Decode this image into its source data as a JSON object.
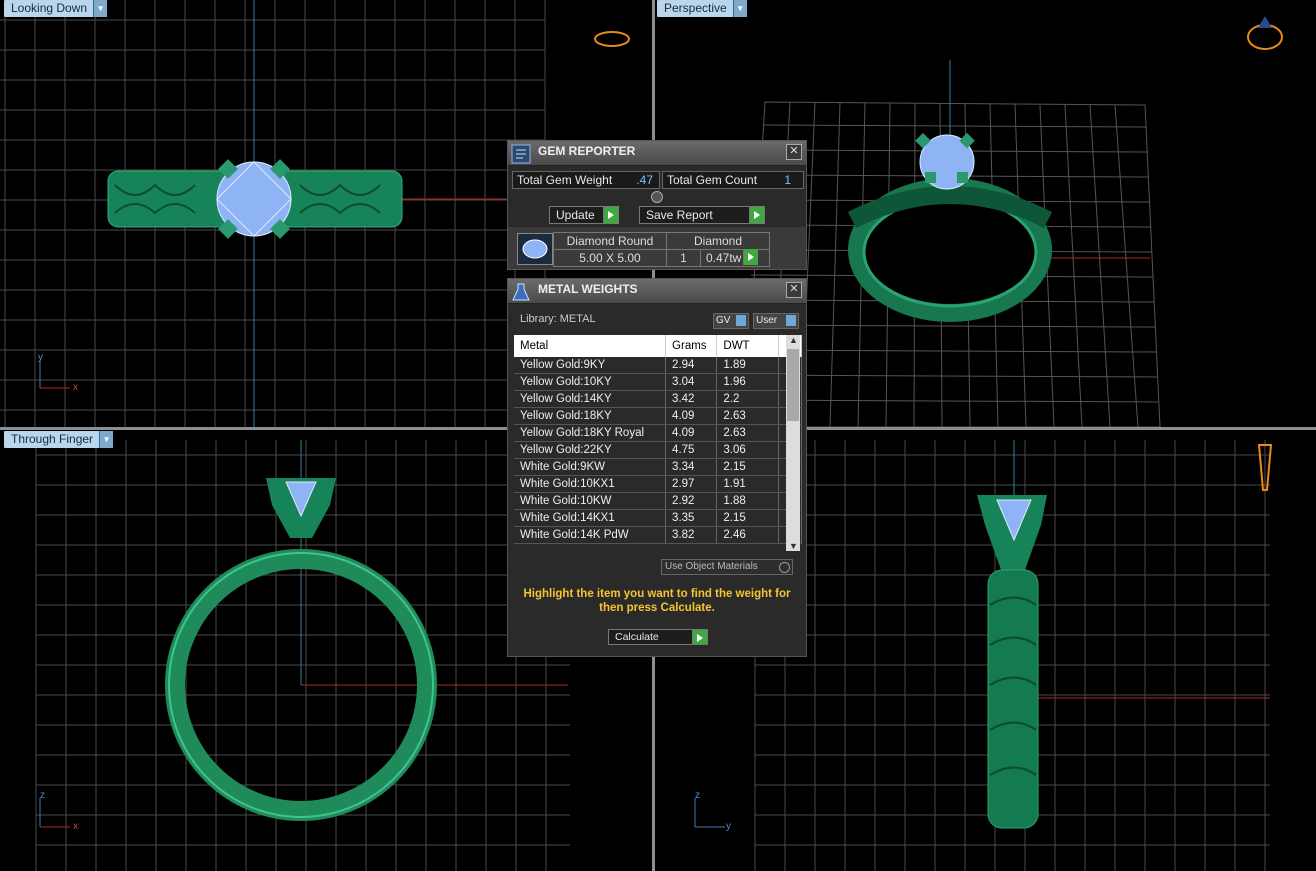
{
  "viewports": {
    "top_left": {
      "label": "Looking Down"
    },
    "top_right": {
      "label": "Perspective"
    },
    "bottom_left": {
      "label": "Through Finger"
    }
  },
  "axes": {
    "y": "y",
    "x": "x",
    "z": "z"
  },
  "gem_reporter": {
    "title": "GEM REPORTER",
    "total_gem_weight_label": "Total Gem Weight",
    "total_gem_weight": ".47",
    "total_gem_count_label": "Total Gem Count",
    "total_gem_count": "1",
    "update_label": "Update",
    "save_report_label": "Save Report",
    "gem": {
      "shape": "Diamond Round",
      "type": "Diamond",
      "size": "5.00 X 5.00",
      "count": "1",
      "weight": "0.47tw"
    }
  },
  "metal_weights": {
    "title": "METAL WEIGHTS",
    "library_label": "Library: METAL",
    "gv_label": "GV",
    "user_label": "User",
    "columns": [
      "Metal",
      "Grams",
      "DWT"
    ],
    "rows": [
      [
        "Yellow Gold:9KY",
        "2.94",
        "1.89"
      ],
      [
        "Yellow Gold:10KY",
        "3.04",
        "1.96"
      ],
      [
        "Yellow Gold:14KY",
        "3.42",
        "2.2"
      ],
      [
        "Yellow Gold:18KY",
        "4.09",
        "2.63"
      ],
      [
        "Yellow Gold:18KY Royal",
        "4.09",
        "2.63"
      ],
      [
        "Yellow Gold:22KY",
        "4.75",
        "3.06"
      ],
      [
        "White Gold:9KW",
        "3.34",
        "2.15"
      ],
      [
        "White Gold:10KX1",
        "2.97",
        "1.91"
      ],
      [
        "White Gold:10KW",
        "2.92",
        "1.88"
      ],
      [
        "White Gold:14KX1",
        "3.35",
        "2.15"
      ],
      [
        "White Gold:14K PdW",
        "3.82",
        "2.46"
      ]
    ],
    "use_object_materials_label": "Use Object Materials",
    "hint": "Highlight the item you want to find the weight for then press Calculate.",
    "calculate_label": "Calculate"
  },
  "colors": {
    "ring_green": "#1f8a5a",
    "gem_blue": "#8fb4f5",
    "grid": "#5a5a5a",
    "accent": "#3fa93f",
    "hint": "#f7c431"
  }
}
